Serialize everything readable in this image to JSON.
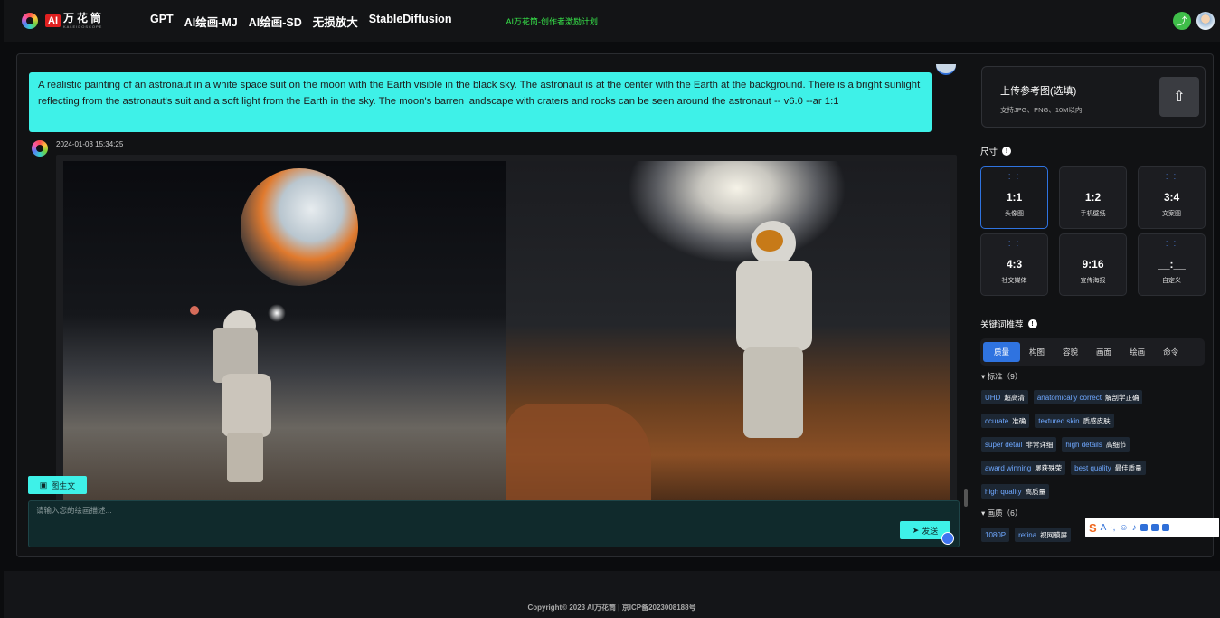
{
  "header": {
    "logo_badge": "AI",
    "logo_text": "万花筒",
    "logo_subtext": "KALEIDOSCOPE",
    "nav": [
      "GPT",
      "AI绘画-MJ",
      "AI绘画-SD",
      "无损放大",
      "StableDiffusion"
    ],
    "promo": "AI万花筒-创作者激励计划",
    "share_icon": "share-icon",
    "avatar_icon": "user-avatar-icon"
  },
  "chat": {
    "prompt": "A realistic painting of an astronaut in a white space suit on the moon with the Earth visible in the black sky. The astronaut is at the center with the Earth at the background. There is a bright sunlight reflecting from the astronaut's suit and a soft light from the Earth in the sky. The moon's barren landscape with craters and rocks can be seen around the astronaut -- v6.0 --ar 1:1",
    "timestamp": "2024-01-03 15:34:25",
    "img2text_label": "图生文",
    "input_placeholder": "请输入您的绘画描述...",
    "send_label": "发送"
  },
  "panel": {
    "upload_title": "上传参考图(选填)",
    "upload_sub": "支持JPG、PNG、10M以内",
    "size_label": "尺寸",
    "sizes": [
      {
        "ratio": "1:1",
        "name": "头像图",
        "active": true
      },
      {
        "ratio": "1:2",
        "name": "手机壁纸"
      },
      {
        "ratio": "3:4",
        "name": "文案图"
      },
      {
        "ratio": "4:3",
        "name": "社交媒体"
      },
      {
        "ratio": "9:16",
        "name": "宣传海报"
      },
      {
        "ratio": "__:__",
        "name": "自定义"
      }
    ],
    "keyword_label": "关键词推荐",
    "tabs": [
      "质量",
      "构图",
      "容貌",
      "画面",
      "绘画",
      "命令"
    ],
    "group1_title": "标准（9）",
    "group2_title": "画质（6）",
    "tags": [
      {
        "en": "UHD",
        "cn": "超高清"
      },
      {
        "en": "anatomically correct",
        "cn": "解剖学正确"
      },
      {
        "en": "ccurate",
        "cn": "准确"
      },
      {
        "en": "textured skin",
        "cn": "质感皮肤"
      },
      {
        "en": "super detail",
        "cn": "非常详细"
      },
      {
        "en": "high details",
        "cn": "高细节"
      },
      {
        "en": "award winning",
        "cn": "屡获殊荣"
      },
      {
        "en": "best quality",
        "cn": "最佳质量"
      },
      {
        "en": "high quality",
        "cn": "高质量"
      },
      {
        "en": "1080P",
        "cn": ""
      },
      {
        "en": "retina",
        "cn": "视网膜屏"
      }
    ]
  },
  "footer": {
    "copyright": "Copyright© 2023 AI万花筒 | 京ICP备2023008188号"
  },
  "colors": {
    "accent": "#3ef1e8",
    "active_blue": "#2f73e0",
    "promo_green": "#37e64a"
  }
}
